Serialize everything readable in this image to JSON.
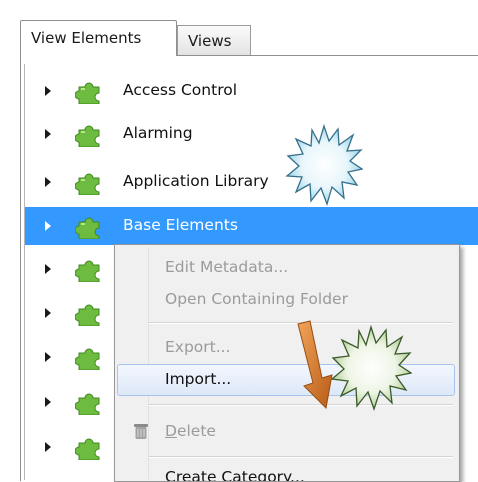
{
  "tabs": [
    {
      "label": "View Elements",
      "active": true
    },
    {
      "label": "Views",
      "active": false
    }
  ],
  "tree": {
    "items": [
      {
        "label": "Access Control"
      },
      {
        "label": "Alarming"
      },
      {
        "label": "Application Library"
      },
      {
        "label": "Base Elements",
        "selected": true
      },
      {
        "label": ""
      },
      {
        "label": ""
      },
      {
        "label": ""
      },
      {
        "label": ""
      },
      {
        "label": ""
      }
    ]
  },
  "context_menu": {
    "items": [
      {
        "label": "Edit Metadata...",
        "enabled": false
      },
      {
        "label": "Open Containing Folder",
        "enabled": false
      },
      {
        "label": "Export...",
        "enabled": false
      },
      {
        "label": "Import...",
        "enabled": true,
        "highlighted": true
      },
      {
        "label": "Delete",
        "enabled": false,
        "icon": "trash-icon",
        "mnemonic": "D"
      },
      {
        "label": "Create Category...",
        "enabled": true
      }
    ]
  },
  "colors": {
    "selection": "#3399ff",
    "puzzle_green": "#6dbb3f",
    "menu_bg": "#f0f0f0",
    "arrow_orange": "#d97a2b"
  }
}
